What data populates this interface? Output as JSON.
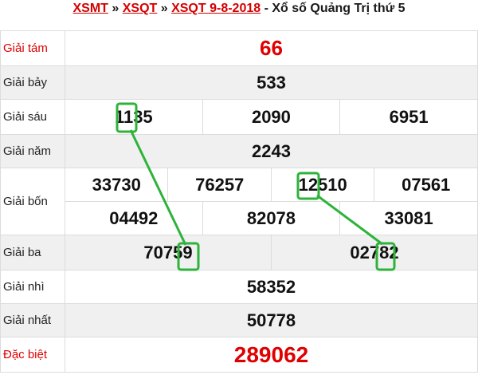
{
  "header": {
    "link1": "XSMT",
    "sep1": " » ",
    "link2": "XSQT",
    "sep2": " » ",
    "link3": "XSQT 9-8-2018",
    "suffix": " - Xổ số Quảng Trị thứ 5"
  },
  "prizes": {
    "tam": {
      "label": "Giải tám",
      "numbers": [
        "66"
      ]
    },
    "bay": {
      "label": "Giải bảy",
      "numbers": [
        "533"
      ]
    },
    "sau": {
      "label": "Giải sáu",
      "numbers": [
        "1135",
        "2090",
        "6951"
      ]
    },
    "nam": {
      "label": "Giải năm",
      "numbers": [
        "2243"
      ]
    },
    "bon": {
      "label": "Giải bốn",
      "numbers": [
        "33730",
        "76257",
        "12510",
        "07561",
        "04492",
        "82078",
        "33081"
      ]
    },
    "ba": {
      "label": "Giải ba",
      "numbers": [
        "70759",
        "02782"
      ]
    },
    "nhi": {
      "label": "Giải nhì",
      "numbers": [
        "58352"
      ]
    },
    "nhat": {
      "label": "Giải nhất",
      "numbers": [
        "50778"
      ]
    },
    "dacbiet": {
      "label": "Đặc biệt",
      "numbers": [
        "289062"
      ]
    }
  },
  "colors": {
    "accent_red": "#e00000",
    "annotation_green": "#2db33a",
    "row_alt": "#f0f0f0"
  }
}
